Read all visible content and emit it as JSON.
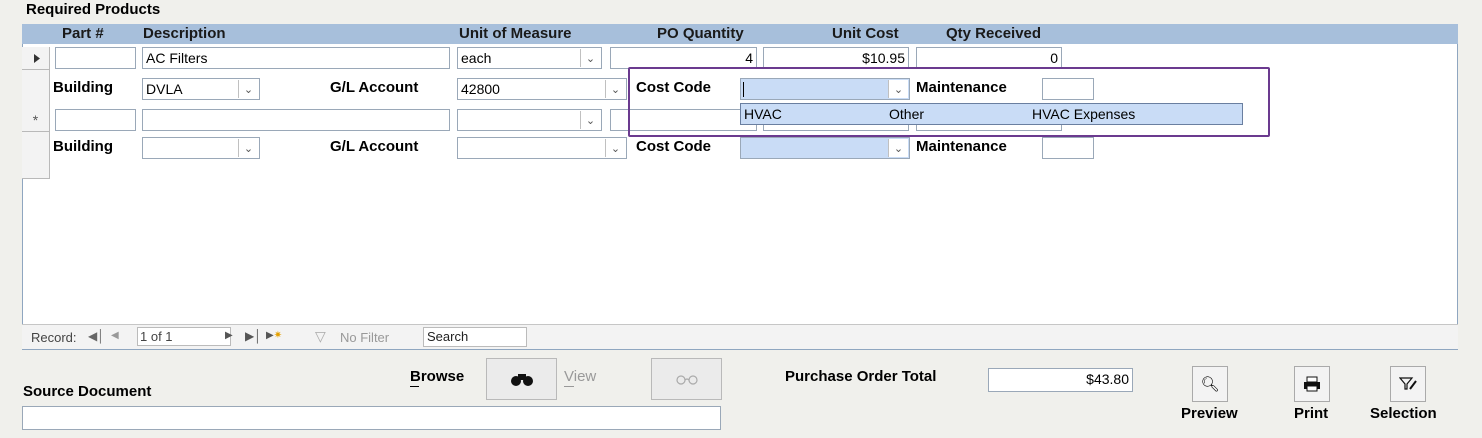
{
  "section_title": "Required Products",
  "columns": {
    "part": "Part #",
    "description": "Description",
    "uom": "Unit of Measure",
    "po_qty": "PO Quantity",
    "unit_cost": "Unit Cost",
    "qty_received": "Qty Received"
  },
  "row1": {
    "part": "",
    "description": "AC Filters",
    "uom": "each",
    "po_qty": "4",
    "unit_cost": "$10.95",
    "qty_received": "0",
    "building_label": "Building",
    "building_value": "DVLA",
    "gl_label": "G/L Account",
    "gl_value": "42800",
    "cost_code_label": "Cost Code",
    "cost_code_value": "",
    "maintenance_label": "Maintenance",
    "maintenance_value": ""
  },
  "new_row": {
    "marker": "*",
    "building_label": "Building",
    "gl_label": "G/L Account",
    "cost_code_label": "Cost Code",
    "maintenance_label": "Maintenance"
  },
  "cost_code_dropdown": {
    "options": [
      {
        "code": "HVAC",
        "type": "Other",
        "description": "HVAC Expenses"
      }
    ]
  },
  "navigation": {
    "record_label": "Record:",
    "position": "1 of 1",
    "filter_label": "No Filter",
    "search_placeholder": "Search"
  },
  "footer": {
    "source_document_label": "Source Document",
    "source_document_value": "",
    "browse_label": "Browse",
    "view_label": "View",
    "po_total_label": "Purchase Order Total",
    "po_total_value": "$43.80",
    "preview_label": "Preview",
    "print_label": "Print",
    "selection_label": "Selection"
  }
}
